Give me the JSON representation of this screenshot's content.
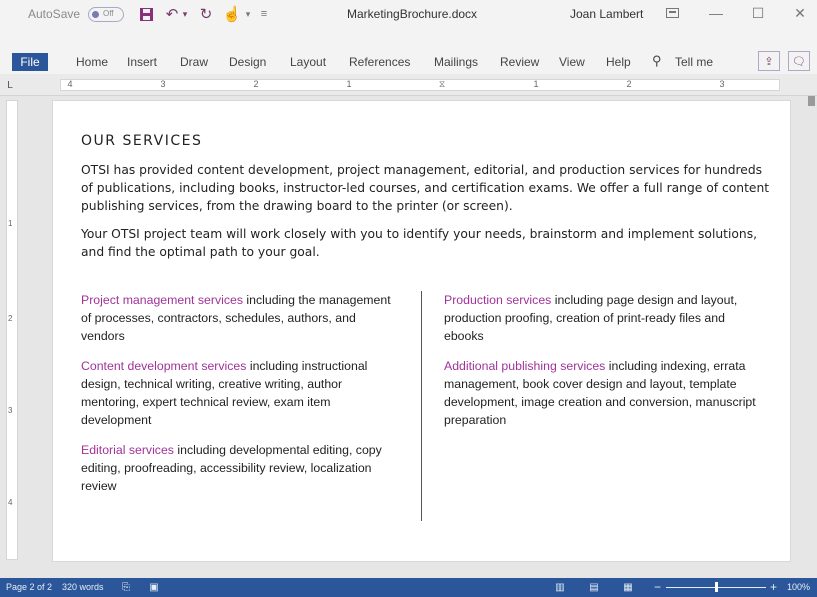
{
  "titlebar": {
    "autosave_label": "AutoSave",
    "autosave_state": "Off",
    "filename": "MarketingBrochure.docx",
    "user": "Joan Lambert",
    "icons": [
      "save-icon",
      "undo-icon",
      "redo-icon",
      "touch-mode-icon",
      "customize-icon",
      "ribbon-display-icon",
      "minimize-icon",
      "maximize-icon",
      "close-icon"
    ]
  },
  "ribbon": {
    "file_label": "File",
    "tabs": [
      "Home",
      "Insert",
      "Draw",
      "Design",
      "Layout",
      "References",
      "Mailings",
      "Review",
      "View",
      "Help"
    ],
    "tell_me": "Tell me"
  },
  "ruler": {
    "labels": [
      "4",
      "3",
      "2",
      "1",
      "1",
      "2",
      "3"
    ]
  },
  "vruler": {
    "labels": [
      "1",
      "2",
      "3",
      "4"
    ]
  },
  "document": {
    "heading": "OUR SERVICES",
    "intro": "OTSI has provided content development, project management, editorial, and production services for hundreds of publications, including books, instructor-led courses, and certification exams. We offer a full range of content publishing services, from the drawing board to the printer (or screen).",
    "team": "Your OTSI project team will work closely with you to identify your needs, brainstorm and implement solutions, and find the optimal path to your goal.",
    "left_column": [
      {
        "name": "Project management services",
        "rest": " including the management of processes, contractors, schedules, authors, and vendors"
      },
      {
        "name": "Content development services",
        "rest": " including instructional design, technical writing, creative writing, author mentoring, expert technical review, exam item development"
      },
      {
        "name": "Editorial services",
        "rest": " including developmental editing, copy editing, proofreading, accessibility review, localization review"
      }
    ],
    "right_column": [
      {
        "name": "Production services",
        "rest": " including page design and layout, production proofing, creation of print-ready files and ebooks"
      },
      {
        "name": "Additional publishing services",
        "rest": " including indexing, errata management, book cover design and layout, template development, image creation and conversion, manuscript preparation"
      }
    ],
    "accent_color": "#a0329a"
  },
  "statusbar": {
    "page": "Page 2 of 2",
    "words": "320 words",
    "zoom": "100%",
    "zoom_level": 0.5,
    "background_color": "#2b579a"
  }
}
